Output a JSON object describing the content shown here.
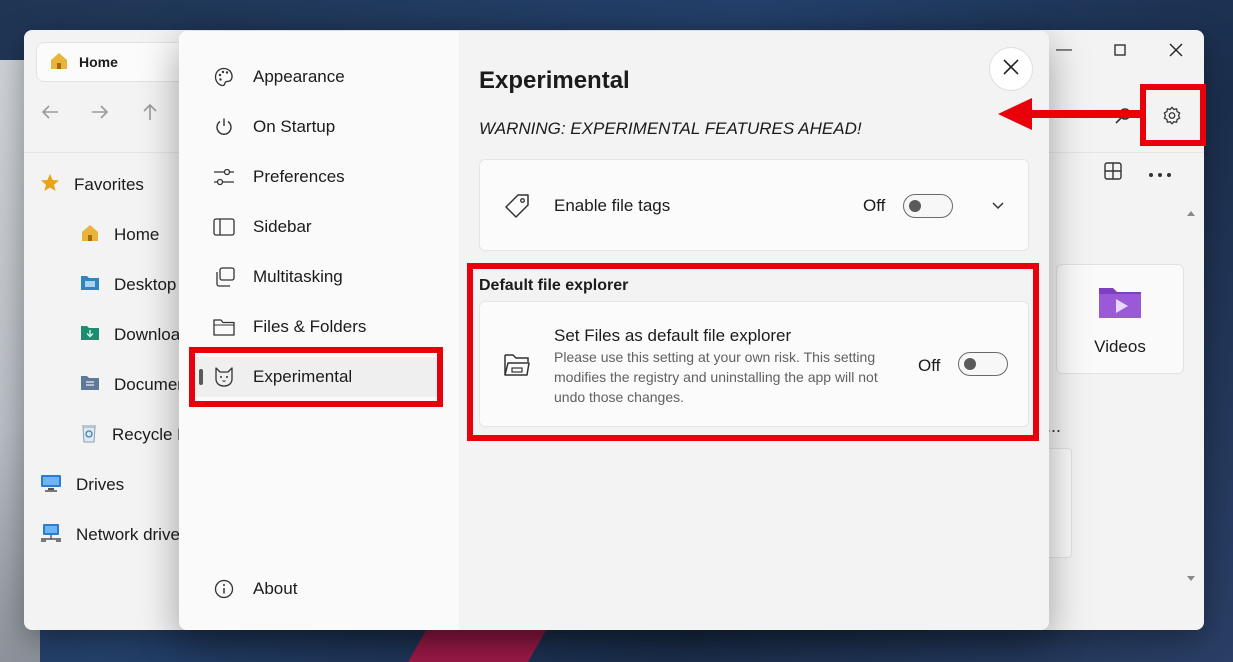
{
  "files_window": {
    "tab_title": "Home",
    "nav_items": [
      {
        "label": "Favorites",
        "icon": "star-icon",
        "sub": false
      },
      {
        "label": "Home",
        "icon": "home-icon",
        "sub": true
      },
      {
        "label": "Desktop",
        "icon": "desktop-folder-icon",
        "sub": true
      },
      {
        "label": "Downloads",
        "icon": "downloads-folder-icon",
        "sub": true
      },
      {
        "label": "Documents",
        "icon": "documents-folder-icon",
        "sub": true
      },
      {
        "label": "Recycle Bin",
        "icon": "recycle-bin-icon",
        "sub": true
      },
      {
        "label": "Drives",
        "icon": "drives-icon",
        "sub": false
      },
      {
        "label": "Network drives",
        "icon": "network-icon",
        "sub": false
      }
    ],
    "videos_label": "Videos",
    "more_dots": "..."
  },
  "settings": {
    "nav": [
      {
        "label": "Appearance",
        "icon": "palette-icon"
      },
      {
        "label": "On Startup",
        "icon": "power-icon"
      },
      {
        "label": "Preferences",
        "icon": "sliders-icon"
      },
      {
        "label": "Sidebar",
        "icon": "sidebar-icon"
      },
      {
        "label": "Multitasking",
        "icon": "multitasking-icon"
      },
      {
        "label": "Files & Folders",
        "icon": "folder-icon"
      },
      {
        "label": "Experimental",
        "icon": "cat-icon",
        "active": true
      }
    ],
    "about": {
      "label": "About",
      "icon": "info-icon"
    },
    "page_title": "Experimental",
    "warning": "WARNING: EXPERIMENTAL FEATURES AHEAD!",
    "file_tags": {
      "title": "Enable file tags",
      "state": "Off",
      "enabled": false
    },
    "section_header": "Default file explorer",
    "default_explorer": {
      "title": "Set Files as default file explorer",
      "description": "Please use this setting at your own risk. This setting modifies the registry and uninstalling the app will not undo those changes.",
      "state": "Off",
      "enabled": false
    }
  },
  "colors": {
    "annotation_red": "#e8000b",
    "accent_purple": "#7b3fbf",
    "folder_yellow": "#e8b43c"
  }
}
